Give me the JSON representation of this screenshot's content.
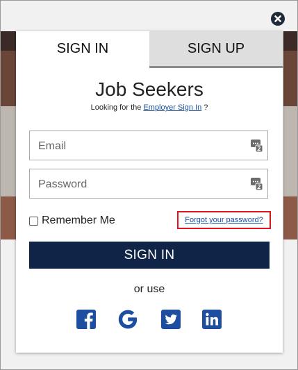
{
  "tabs": {
    "signin": "SIGN IN",
    "signup": "SIGN UP"
  },
  "heading": {
    "title": "Job Seekers",
    "prefix": "Looking for the ",
    "link": "Employer Sign In",
    "suffix": " ?"
  },
  "form": {
    "email_placeholder": "Email",
    "password_placeholder": "Password",
    "remember_label": "Remember Me",
    "forgot_link": "Forgot your password?",
    "submit_label": "SIGN IN"
  },
  "alt": {
    "label": "or use"
  },
  "social": [
    "facebook-icon",
    "google-icon",
    "twitter-icon",
    "linkedin-icon"
  ],
  "colors": {
    "brand_navy": "#0f2446",
    "social_blue": "#1d4ea0",
    "highlight_red": "#e0141e"
  }
}
